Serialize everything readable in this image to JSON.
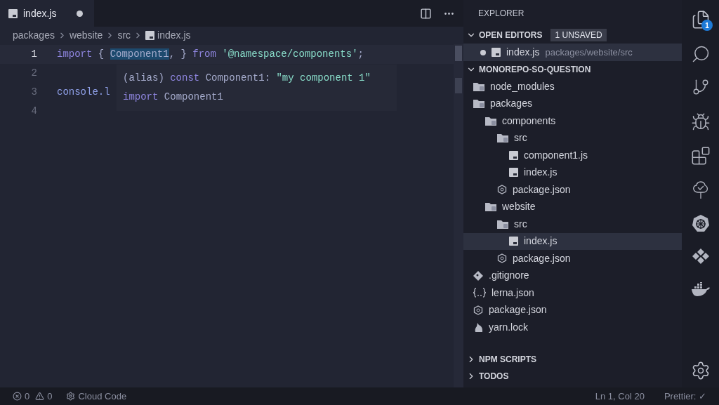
{
  "editor": {
    "tab": {
      "label": "index.js",
      "modified": true,
      "selected": true
    },
    "breadcrumbs": [
      "packages",
      "website",
      "src",
      "index.js"
    ],
    "lines": [
      {
        "number": "1",
        "active": true,
        "tokens": [
          {
            "text": "import",
            "kind": "keyword",
            "highlighted": false
          },
          {
            "text": "{",
            "kind": "punct",
            "highlighted": false
          },
          {
            "text": "Component1",
            "kind": "ident",
            "highlighted": true
          },
          {
            "text": ",",
            "kind": "punct",
            "highlighted": false
          },
          {
            "text": "}",
            "kind": "punct",
            "highlighted": false
          },
          {
            "text": "from",
            "kind": "keyword",
            "highlighted": false
          },
          {
            "text": "'@namespace/components'",
            "kind": "string",
            "highlighted": false
          },
          {
            "text": ";",
            "kind": "punct",
            "highlighted": false
          }
        ]
      },
      {
        "number": "2",
        "active": false
      },
      {
        "number": "3",
        "active": false,
        "tokens": [
          {
            "text": "console.l",
            "kind": "object",
            "highlighted": false
          }
        ]
      },
      {
        "number": "4",
        "active": false
      }
    ],
    "hover": [
      [
        {
          "text": "(alias)",
          "kind": "punct"
        },
        {
          "text": "const",
          "kind": "keyword"
        },
        {
          "text": "Component1:",
          "kind": "ident"
        },
        {
          "text": "\"my component 1\"",
          "kind": "string"
        }
      ],
      [
        {
          "text": "import",
          "kind": "keyword"
        },
        {
          "text": "Component1",
          "kind": "ident"
        }
      ]
    ]
  },
  "sidebar": {
    "title": "EXPLORER",
    "open_editors": {
      "title": "OPEN EDITORS",
      "expanded": true,
      "badge": "1 UNSAVED",
      "items": [
        {
          "name": "index.js",
          "path": "packages/website/src",
          "modified": true,
          "selected": true
        }
      ]
    },
    "workspace": {
      "title": "MONOREPO-SO-QUESTION",
      "expanded": true,
      "tree": [
        {
          "name": "node_modules",
          "kind": "folder",
          "selected": false
        },
        {
          "name": "packages",
          "kind": "folder",
          "selected": false,
          "children": [
            {
              "name": "components",
              "kind": "folder",
              "selected": false,
              "children": [
                {
                  "name": "src",
                  "kind": "folder",
                  "selected": false,
                  "children": [
                    {
                      "name": "component1.js",
                      "kind": "js",
                      "selected": false
                    },
                    {
                      "name": "index.js",
                      "kind": "js",
                      "selected": false
                    }
                  ]
                },
                {
                  "name": "package.json",
                  "kind": "npm",
                  "selected": false
                }
              ]
            },
            {
              "name": "website",
              "kind": "folder",
              "selected": false,
              "children": [
                {
                  "name": "src",
                  "kind": "folder",
                  "selected": false,
                  "children": [
                    {
                      "name": "index.js",
                      "kind": "js",
                      "selected": true
                    }
                  ]
                },
                {
                  "name": "package.json",
                  "kind": "npm",
                  "selected": false
                }
              ]
            }
          ]
        },
        {
          "name": ".gitignore",
          "kind": "git",
          "selected": false
        },
        {
          "name": "lerna.json",
          "kind": "json",
          "selected": false
        },
        {
          "name": "package.json",
          "kind": "npm",
          "selected": false
        },
        {
          "name": "yarn.lock",
          "kind": "yarn",
          "selected": false
        }
      ]
    },
    "collapsed_sections": [
      {
        "title": "NPM SCRIPTS",
        "expanded": false
      },
      {
        "title": "TODOS",
        "expanded": false
      }
    ]
  },
  "activity_bar": [
    {
      "kind": "files",
      "selected": true,
      "badge": "1"
    },
    {
      "kind": "search",
      "selected": false
    },
    {
      "kind": "git",
      "selected": false
    },
    {
      "kind": "debug",
      "selected": false
    },
    {
      "kind": "extensions",
      "selected": false
    },
    {
      "kind": "tree",
      "selected": false
    },
    {
      "kind": "helm",
      "selected": false
    },
    {
      "kind": "diamonds",
      "selected": false
    },
    {
      "kind": "docker",
      "selected": false
    }
  ],
  "status_bar": {
    "errors": "0",
    "warnings": "0",
    "cloud": "Cloud Code",
    "position": "Ln 1, Col 20",
    "formatter": "Prettier: ✓"
  }
}
